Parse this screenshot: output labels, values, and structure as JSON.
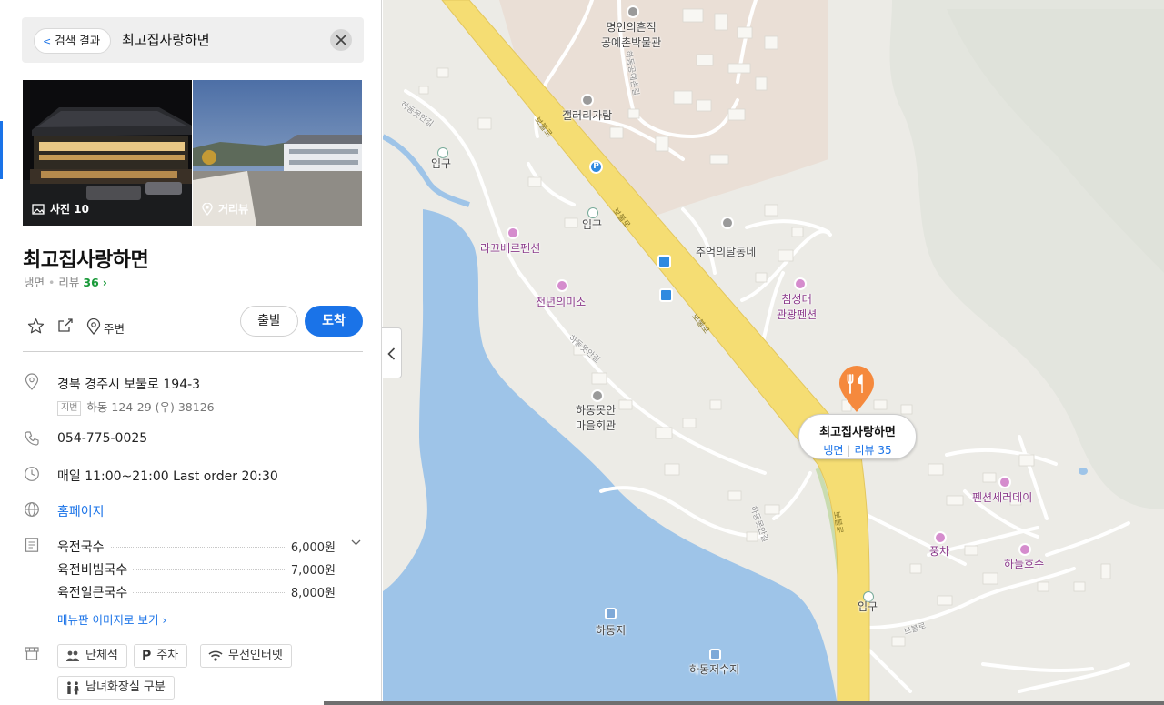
{
  "search": {
    "back_label": "검색 결과",
    "query": "최고집사랑하면"
  },
  "photos": [
    {
      "label": "사진 10",
      "icon": "photo-icon"
    },
    {
      "label": "거리뷰",
      "icon": "location-pin-icon"
    }
  ],
  "place": {
    "name": "최고집사랑하면",
    "category": "냉면",
    "review_label": "리뷰",
    "review_count": "36",
    "review_chevron": "›"
  },
  "actions": {
    "around_label": "주변",
    "depart_label": "출발",
    "arrive_label": "도착"
  },
  "info": {
    "address": "경북 경주시 보불로 194-3",
    "jibun_tag": "지번",
    "jibun_address": "하동 124-29 (우) 38126",
    "phone": "054-775-0025",
    "hours": "매일 11:00~21:00 Last order 20:30",
    "homepage": "홈페이지"
  },
  "menu": {
    "items": [
      {
        "name": "육전국수",
        "price": "6,000원"
      },
      {
        "name": "육전비빔국수",
        "price": "7,000원"
      },
      {
        "name": "육전얼큰국수",
        "price": "8,000원"
      }
    ],
    "more_label": "메뉴판 이미지로 보기 ›"
  },
  "facilities": [
    {
      "label": "단체석",
      "icon": "group-icon"
    },
    {
      "label": "주차",
      "icon": "parking-icon"
    },
    {
      "label": "무선인터넷",
      "icon": "wifi-icon"
    },
    {
      "label": "남녀화장실 구분",
      "icon": "restroom-icon"
    }
  ],
  "map": {
    "labels": {
      "museum": "명인의흔적\n공예촌박물관",
      "gallery": "갤러리가람",
      "entrance_1": "입구",
      "entrance_2": "입구",
      "entrance_3": "입구",
      "lapver": "라끄베르펜션",
      "memory": "추억의달동네",
      "cheonnyeon": "천년의미소",
      "cheomseongdae": "첨성대\n관광펜션",
      "hall": "하동못안\n마을회관",
      "pension_sera": "펜션세러데이",
      "pungcha": "풍차",
      "haneul": "하늘호수",
      "hadongji": "하동지",
      "reservoir": "하동저수지",
      "road_bobul_1": "보불로",
      "road_bobul_2": "보불로",
      "road_bobul_3": "보불로",
      "road_bobul_4": "보불로",
      "road_bobul_5": "보불로",
      "road_hadong_1": "하동못안길",
      "road_hadong_2": "하동못안길",
      "road_hadong_3": "하동못안길",
      "road_gongye": "하동공예촌길"
    },
    "marker": {
      "name": "최고집사랑하면",
      "category": "냉면",
      "review_label": "리뷰 35"
    },
    "colors": {
      "land": "#ecebe6",
      "water": "#9ec4e8",
      "highway": "#f5dd73",
      "pin": "#f5893d"
    }
  }
}
